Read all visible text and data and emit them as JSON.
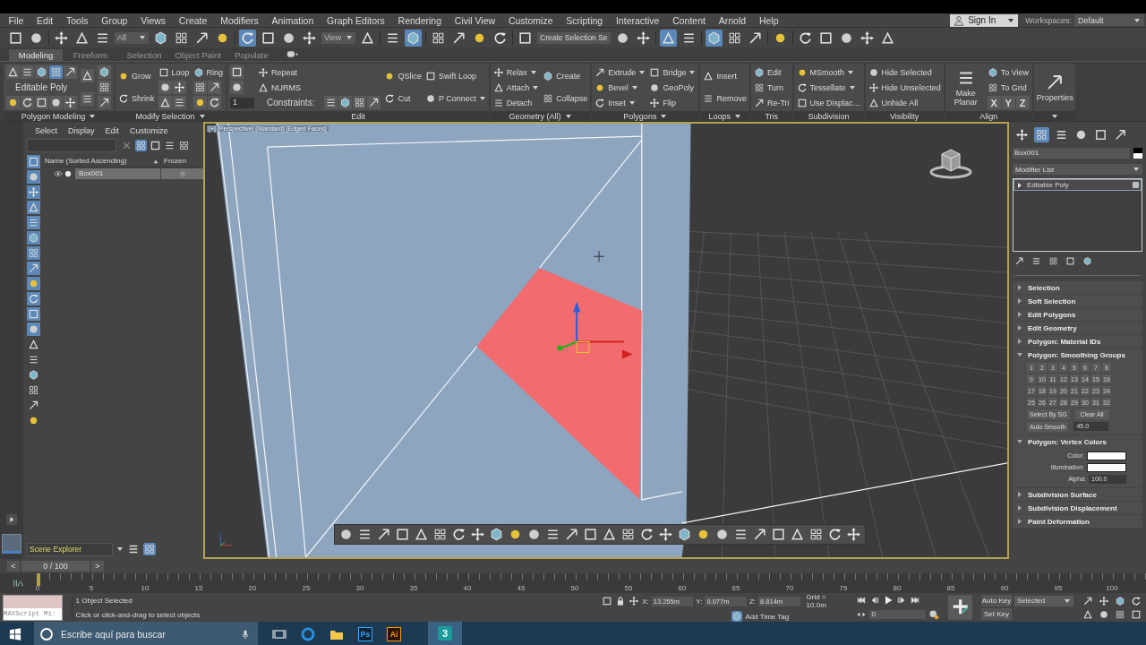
{
  "menu": [
    "File",
    "Edit",
    "Tools",
    "Group",
    "Views",
    "Create",
    "Modifiers",
    "Animation",
    "Graph Editors",
    "Rendering",
    "Civil View",
    "Customize",
    "Scripting",
    "Interactive",
    "Content",
    "Arnold",
    "Help"
  ],
  "account": {
    "label": "Sign In"
  },
  "workspaces": {
    "label": "Workspaces:",
    "value": "Default"
  },
  "toolbar": [
    {
      "kind": "icon",
      "selected": false
    },
    {
      "kind": "icon",
      "selected": false
    },
    {
      "kind": "separator"
    },
    {
      "kind": "icon",
      "selected": false
    },
    {
      "kind": "icon",
      "selected": false
    },
    {
      "kind": "icon",
      "selected": false
    },
    {
      "kind": "dropdown",
      "value": "All"
    },
    {
      "kind": "icon",
      "selected": false
    },
    {
      "kind": "icon",
      "selected": false
    },
    {
      "kind": "icon",
      "selected": false
    },
    {
      "kind": "icon",
      "selected": false
    },
    {
      "kind": "separator"
    },
    {
      "kind": "icon",
      "selected": true
    },
    {
      "kind": "icon",
      "selected": false
    },
    {
      "kind": "icon",
      "selected": false
    },
    {
      "kind": "icon",
      "selected": false
    },
    {
      "kind": "dropdown",
      "value": "View"
    },
    {
      "kind": "icon",
      "selected": false
    },
    {
      "kind": "separator"
    },
    {
      "kind": "icon",
      "selected": false
    },
    {
      "kind": "icon",
      "selected": true
    },
    {
      "kind": "separator"
    },
    {
      "kind": "icon",
      "selected": false
    },
    {
      "kind": "icon",
      "selected": false
    },
    {
      "kind": "icon",
      "selected": false
    },
    {
      "kind": "icon",
      "selected": false
    },
    {
      "kind": "separator"
    },
    {
      "kind": "icon",
      "selected": false
    },
    {
      "kind": "field",
      "value": "Create Selection Se"
    },
    {
      "kind": "icon",
      "selected": false
    },
    {
      "kind": "icon",
      "selected": false
    },
    {
      "kind": "separator"
    },
    {
      "kind": "icon",
      "selected": true
    },
    {
      "kind": "icon",
      "selected": false
    },
    {
      "kind": "separator"
    },
    {
      "kind": "icon",
      "selected": true
    },
    {
      "kind": "icon",
      "selected": false
    },
    {
      "kind": "icon",
      "selected": false
    },
    {
      "kind": "separator"
    },
    {
      "kind": "icon",
      "selected": false
    },
    {
      "kind": "separator"
    },
    {
      "kind": "icon",
      "selected": false
    },
    {
      "kind": "icon",
      "selected": false
    },
    {
      "kind": "icon",
      "selected": false
    },
    {
      "kind": "icon",
      "selected": false
    },
    {
      "kind": "icon",
      "selected": false
    }
  ],
  "ribbon": {
    "tabs": [
      {
        "label": "Modeling",
        "selected": true
      },
      {
        "label": "Freeform",
        "selected": false
      },
      {
        "label": "Selection",
        "selected": false
      },
      {
        "label": "Object Paint",
        "selected": false
      },
      {
        "label": "Populate",
        "selected": false
      }
    ],
    "panels": [
      {
        "title": "Polygon Modeling",
        "menu": true,
        "cols": [
          [
            [
              {
                "kind": "icon"
              },
              {
                "kind": "icon"
              },
              {
                "kind": "icon"
              },
              {
                "kind": "icon",
                "selected": true
              },
              {
                "kind": "icon"
              }
            ],
            [
              {
                "kind": "text",
                "label": "Editable Poly"
              }
            ],
            [
              {
                "kind": "icon"
              },
              {
                "kind": "icon"
              },
              {
                "kind": "icon"
              },
              {
                "kind": "icon"
              },
              {
                "kind": "icon"
              }
            ]
          ],
          [
            [
              {
                "kind": "icon"
              }
            ],
            [
              {
                "kind": "icon"
              }
            ]
          ],
          [
            [
              {
                "kind": "icon"
              }
            ],
            [
              {
                "kind": "icon"
              }
            ],
            [
              {
                "kind": "icon"
              }
            ]
          ]
        ]
      },
      {
        "title": "Modify Selection",
        "menu": true,
        "cols": [
          [
            [
              {
                "kind": "tool",
                "label": "Grow"
              }
            ],
            [
              {
                "kind": "tool",
                "label": "Shrink"
              }
            ]
          ],
          [
            [
              {
                "kind": "tool",
                "label": "Loop"
              }
            ],
            [
              {
                "kind": "icon"
              },
              {
                "kind": "icon"
              }
            ],
            [
              {
                "kind": "icon"
              },
              {
                "kind": "icon"
              }
            ]
          ],
          [
            [
              {
                "kind": "tool",
                "label": "Ring"
              }
            ],
            [
              {
                "kind": "icon"
              },
              {
                "kind": "icon"
              }
            ],
            [
              {
                "kind": "icon"
              },
              {
                "kind": "icon"
              }
            ]
          ]
        ]
      },
      {
        "title": "Edit",
        "menu": false,
        "cols": [
          [
            [
              {
                "kind": "icon"
              }
            ],
            [
              {
                "kind": "icon"
              }
            ],
            [
              {
                "kind": "spinner",
                "label": "1"
              }
            ]
          ],
          [
            [
              {
                "kind": "tool",
                "label": "Repeat"
              }
            ],
            [
              {
                "kind": "tool",
                "label": "NURMS"
              }
            ],
            [
              {
                "kind": "text",
                "label": "Constraints:"
              },
              {
                "kind": "icon"
              },
              {
                "kind": "icon"
              },
              {
                "kind": "icon"
              },
              {
                "kind": "icon"
              }
            ]
          ],
          [
            [
              {
                "kind": "tool",
                "label": "QSlice"
              }
            ],
            [
              {
                "kind": "tool",
                "label": "Cut"
              }
            ]
          ],
          [
            [
              {
                "kind": "tool",
                "label": "Swift Loop"
              }
            ],
            [
              {
                "kind": "tool",
                "label": "P Connect",
                "menu": true
              }
            ]
          ]
        ]
      },
      {
        "title": "Geometry (All)",
        "menu": true,
        "cols": [
          [
            [
              {
                "kind": "tool",
                "label": "Relax",
                "menu": true
              }
            ],
            [
              {
                "kind": "tool",
                "label": "Attach",
                "menu": true
              }
            ],
            [
              {
                "kind": "tool",
                "label": "Detach"
              }
            ]
          ],
          [
            [
              {
                "kind": "tool",
                "label": "Create"
              }
            ],
            [
              {
                "kind": "tool",
                "label": "Collapse"
              }
            ]
          ]
        ]
      },
      {
        "title": "Polygons",
        "menu": true,
        "cols": [
          [
            [
              {
                "kind": "tool",
                "label": "Extrude",
                "menu": true
              }
            ],
            [
              {
                "kind": "tool",
                "label": "Bevel",
                "menu": true
              }
            ],
            [
              {
                "kind": "tool",
                "label": "Inset",
                "menu": true
              }
            ]
          ],
          [
            [
              {
                "kind": "tool",
                "label": "Bridge",
                "menu": true
              }
            ],
            [
              {
                "kind": "tool",
                "label": "GeoPoly"
              }
            ],
            [
              {
                "kind": "tool",
                "label": "Flip"
              }
            ]
          ]
        ]
      },
      {
        "title": "Loops",
        "menu": true,
        "cols": [
          [
            [
              {
                "kind": "tool",
                "label": "Insert"
              }
            ],
            [
              {
                "kind": "tool",
                "label": "Remove"
              }
            ]
          ]
        ]
      },
      {
        "title": "Tris",
        "menu": false,
        "cols": [
          [
            [
              {
                "kind": "tool",
                "label": "Edit"
              }
            ],
            [
              {
                "kind": "tool",
                "label": "Turn"
              }
            ],
            [
              {
                "kind": "tool",
                "label": "Re-Tri"
              }
            ]
          ]
        ]
      },
      {
        "title": "Subdivision",
        "menu": false,
        "cols": [
          [
            [
              {
                "kind": "tool",
                "label": "MSmooth",
                "menu": true
              }
            ],
            [
              {
                "kind": "tool",
                "label": "Tessellate",
                "menu": true
              }
            ],
            [
              {
                "kind": "tool",
                "label": "Use Displac…"
              }
            ]
          ]
        ]
      },
      {
        "title": "Visibility",
        "menu": false,
        "cols": [
          [
            [
              {
                "kind": "tool",
                "label": "Hide Selected"
              }
            ],
            [
              {
                "kind": "tool",
                "label": "Hide Unselected"
              }
            ],
            [
              {
                "kind": "tool",
                "label": "Unhide All"
              }
            ]
          ]
        ]
      },
      {
        "title": "Align",
        "menu": false,
        "cols": [
          [
            [
              {
                "kind": "big",
                "label": "Make Planar"
              }
            ]
          ],
          [
            [
              {
                "kind": "tool",
                "label": "To View"
              }
            ],
            [
              {
                "kind": "tool",
                "label": "To Grid"
              }
            ],
            [
              {
                "kind": "key",
                "label": "X"
              },
              {
                "kind": "key",
                "label": "Y"
              },
              {
                "kind": "key",
                "label": "Z"
              }
            ]
          ]
        ]
      },
      {
        "menu": true,
        "cols": [
          [
            [
              {
                "kind": "big",
                "label": "Properties"
              }
            ]
          ]
        ]
      }
    ]
  },
  "scene_explorer": {
    "menu": [
      "Select",
      "Display",
      "Edit",
      "Customize"
    ],
    "columns": [
      "Name (Sorted Ascending)",
      "Frozen"
    ],
    "rows": [
      {
        "name": "Box001",
        "selected": true
      }
    ],
    "explorer": "Scene Explorer"
  },
  "viewport": {
    "label": "[+] [Perspective] [Standard] [Edged Faces]",
    "active": true
  },
  "command_panel": {
    "tabs": [
      {
        "selected": false
      },
      {
        "selected": true
      },
      {
        "selected": false
      },
      {
        "selected": false
      },
      {
        "selected": false
      },
      {
        "selected": false
      }
    ],
    "object_name": "Box001",
    "modifier_list": "Modifier List",
    "stack": [
      {
        "label": "Editable Poly",
        "selected": true
      }
    ],
    "rollouts": [
      {
        "title": "Selection",
        "expanded": false
      },
      {
        "title": "Soft Selection",
        "expanded": false
      },
      {
        "title": "Edit Polygons",
        "expanded": false
      },
      {
        "title": "Edit Geometry",
        "expanded": false
      },
      {
        "title": "Polygon: Material IDs",
        "expanded": false
      },
      {
        "title": "Polygon: Smoothing Groups",
        "expanded": true,
        "kind": "smoothing",
        "groups": [
          "1",
          "2",
          "3",
          "4",
          "5",
          "6",
          "7",
          "8",
          "9",
          "10",
          "11",
          "12",
          "13",
          "14",
          "15",
          "16",
          "17",
          "18",
          "19",
          "20",
          "21",
          "22",
          "23",
          "24",
          "25",
          "26",
          "27",
          "28",
          "29",
          "30",
          "31",
          "32"
        ],
        "buttons": [
          "Select By SG",
          "Clear All"
        ],
        "auto_smooth": "Auto Smooth",
        "threshold": "45.0"
      },
      {
        "title": "Polygon: Vertex Colors",
        "expanded": true,
        "kind": "vertex_colors",
        "fields": [
          {
            "label": "Color:",
            "kind": "swatch",
            "color": "#ffffff"
          },
          {
            "label": "Illumination:",
            "kind": "swatch",
            "color": "#ffffff"
          },
          {
            "label": "Alpha:",
            "kind": "spinner",
            "value": "100.0"
          }
        ]
      },
      {
        "title": "Subdivision Surface",
        "expanded": false
      },
      {
        "title": "Subdivision Displacement",
        "expanded": false
      },
      {
        "title": "Paint Deformation",
        "expanded": false
      }
    ]
  },
  "time_slider": {
    "prev": "<",
    "position": "0 / 100",
    "next": ">",
    "ticks": [
      "0",
      "5",
      "10",
      "15",
      "20",
      "25",
      "30",
      "35",
      "40",
      "45",
      "50",
      "55",
      "60",
      "65",
      "70",
      "75",
      "80",
      "85",
      "90",
      "95",
      "100"
    ]
  },
  "status": {
    "listener": "MAXScript Mi:",
    "prompt": "1 Object Selected",
    "hint": "Click or click-and-drag to select objects",
    "coords": [
      {
        "axis": "X:",
        "value": "13.255m"
      },
      {
        "axis": "Y:",
        "value": "0.077m"
      },
      {
        "axis": "Z:",
        "value": "8.814m"
      }
    ],
    "grid": "Grid = 10.0m",
    "time_tag": "Add Time Tag",
    "frame": "0",
    "auto_key": "Auto Key",
    "set_key": "Set Key",
    "key_mode": "Selected"
  },
  "taskbar": {
    "search": "Escribe aquí para buscar",
    "apps": [
      {
        "kind": "task_view",
        "selected": false
      },
      {
        "kind": "edge",
        "selected": false
      },
      {
        "kind": "folder",
        "selected": false
      },
      {
        "kind": "ps",
        "label": "Ps",
        "selected": false
      },
      {
        "kind": "ai",
        "label": "Ai",
        "selected": false
      },
      {
        "kind": "max",
        "label": "3",
        "selected": true
      }
    ]
  }
}
